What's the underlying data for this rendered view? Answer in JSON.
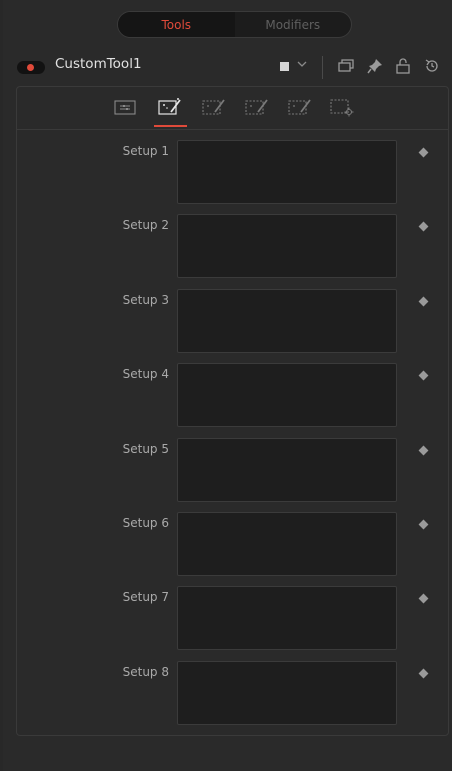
{
  "tabs": {
    "tools_label": "Tools",
    "modifiers_label": "Modifiers",
    "active": "Tools"
  },
  "tool": {
    "name": "CustomTool1",
    "power_color": "#e04a3a",
    "swatch_color": "#d6d6d6"
  },
  "header_icons": [
    "color-swatch",
    "chevron-down-icon",
    "view-window-icon",
    "pin-icon",
    "lock-icon",
    "reset-icon"
  ],
  "inspector_tabs": [
    {
      "name": "controls-tab-icon",
      "active": false
    },
    {
      "name": "setup-tab-icon",
      "active": true
    },
    {
      "name": "intermediate-tab-icon",
      "active": false
    },
    {
      "name": "channels-tab-icon",
      "active": false
    },
    {
      "name": "expression-tab-icon",
      "active": false
    },
    {
      "name": "settings-tab-icon",
      "active": false
    }
  ],
  "setups": [
    {
      "label": "Setup 1",
      "value": ""
    },
    {
      "label": "Setup 2",
      "value": ""
    },
    {
      "label": "Setup 3",
      "value": ""
    },
    {
      "label": "Setup 4",
      "value": ""
    },
    {
      "label": "Setup 5",
      "value": ""
    },
    {
      "label": "Setup 6",
      "value": ""
    },
    {
      "label": "Setup 7",
      "value": ""
    },
    {
      "label": "Setup 8",
      "value": ""
    }
  ],
  "colors": {
    "accent": "#e04a3a",
    "panel_bg": "#2a2a2a",
    "field_bg": "#1e1e1e"
  }
}
